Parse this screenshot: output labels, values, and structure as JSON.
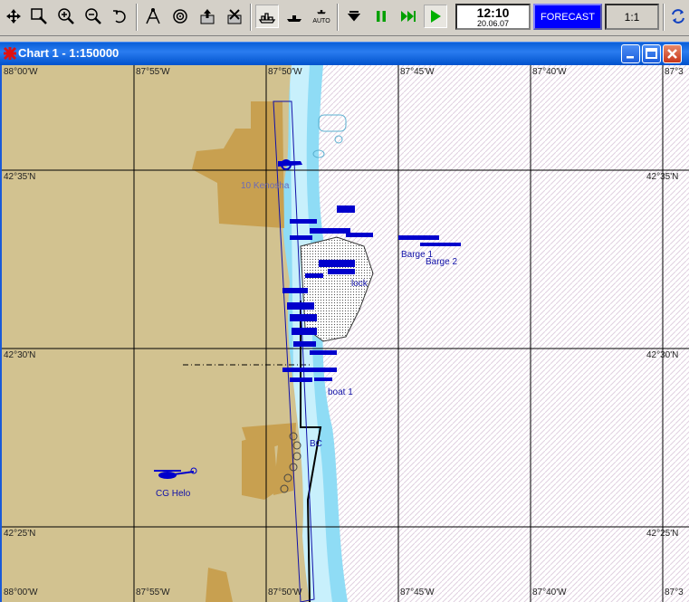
{
  "toolbar": {
    "buttons": [
      {
        "name": "pan-icon"
      },
      {
        "name": "zoom-window-icon"
      },
      {
        "name": "zoom-in-icon"
      },
      {
        "name": "zoom-out-icon"
      },
      {
        "name": "undo-icon"
      },
      {
        "name": "measure-icon"
      },
      {
        "name": "target-icon"
      },
      {
        "name": "export-icon"
      },
      {
        "name": "import-icon"
      },
      {
        "name": "ship-mode-icon"
      },
      {
        "name": "vessel-icon"
      },
      {
        "name": "auto-vessel-icon"
      },
      {
        "name": "stop-icon"
      },
      {
        "name": "pause-icon"
      },
      {
        "name": "fast-forward-icon"
      },
      {
        "name": "play-icon"
      }
    ],
    "auto_label": "AUTO",
    "clock_time": "12:10",
    "clock_date": "20.06.07",
    "forecast_label": "FORECAST",
    "scale_label": "1:1"
  },
  "window": {
    "title": "Chart 1 - 1:150000"
  },
  "map": {
    "top_longitudes": [
      "88°00'W",
      "87°55'W",
      "87°50'W",
      "87°45'W",
      "87°40'W",
      "87°3"
    ],
    "bottom_longitudes": [
      "88°00'W",
      "87°55'W",
      "87°50'W",
      "87°45'W",
      "87°40'W",
      "87°3"
    ],
    "left_latitudes": [
      "42°35'N",
      "42°30'N",
      "42°25'N"
    ],
    "right_latitudes": [
      "42°35'N",
      "42°30'N",
      "42°25'N"
    ],
    "labels": {
      "kenosha": "10 Kenosha",
      "barge1": "Barge 1",
      "barge2": "Barge 2",
      "boat1": "boat 1",
      "cg_helo": "CG Helo",
      "lock": "lock",
      "bcl": "BC"
    },
    "colors": {
      "land": "#d2c290",
      "urban": "#c8a050",
      "shallow": "#7fd0f0",
      "deep": "#ffffff",
      "vessel": "#0000cc"
    }
  }
}
